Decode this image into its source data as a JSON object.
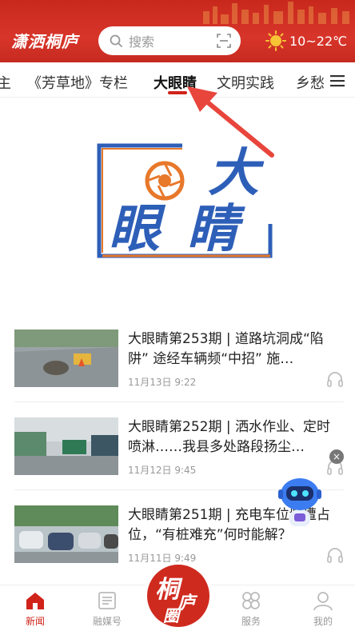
{
  "header": {
    "brand": "潇洒桐庐",
    "search_placeholder": "搜索",
    "temperature": "10~22℃"
  },
  "tabs": [
    {
      "label": "主"
    },
    {
      "label": "《芳草地》专栏"
    },
    {
      "label": "大眼睛"
    },
    {
      "label": "文明实践"
    },
    {
      "label": "乡愁"
    }
  ],
  "banner": {
    "char_big": "大",
    "char_1": "眼",
    "char_2": "睛"
  },
  "news": [
    {
      "title": "大眼睛第253期 | 道路坑洞成“陷阱” 途经车辆频“中招” 施…",
      "date": "11月13日 9:22"
    },
    {
      "title": "大眼睛第252期 | 洒水作业、定时喷淋……我县多处路段扬尘…",
      "date": "11月12日 9:45"
    },
    {
      "title": "大眼睛第251期 | 充电车位频遭占位，“有桩难充”何时能解？",
      "date": "11月11日 9:49"
    }
  ],
  "float": {
    "close": "×"
  },
  "bottom_nav": {
    "items": [
      {
        "label": "新闻"
      },
      {
        "label": "融媒号"
      },
      {
        "label": "服务"
      },
      {
        "label": "我的"
      }
    ],
    "center": {
      "c1": "桐",
      "c2": "庐",
      "c3": "圈"
    }
  },
  "colors": {
    "brand_red": "#d0231a",
    "banner_blue": "#2e5fb8",
    "banner_orange": "#e8782a"
  }
}
